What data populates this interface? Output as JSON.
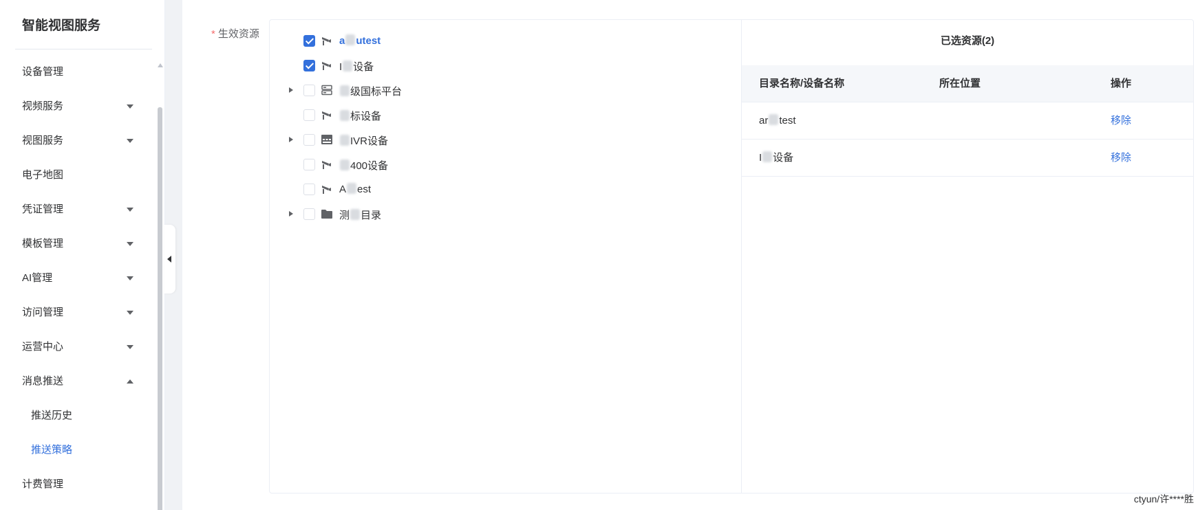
{
  "sidebar": {
    "brand": "智能视图服务",
    "items": [
      {
        "label": "设备管理",
        "caret": "none"
      },
      {
        "label": "视频服务",
        "caret": "down"
      },
      {
        "label": "视图服务",
        "caret": "down"
      },
      {
        "label": "电子地图",
        "caret": "none"
      },
      {
        "label": "凭证管理",
        "caret": "down"
      },
      {
        "label": "模板管理",
        "caret": "down"
      },
      {
        "label": "AI管理",
        "caret": "down"
      },
      {
        "label": "访问管理",
        "caret": "down"
      },
      {
        "label": "运营中心",
        "caret": "down"
      },
      {
        "label": "消息推送",
        "caret": "up"
      },
      {
        "label": "推送历史",
        "sub": true
      },
      {
        "label": "推送策略",
        "sub": true,
        "active": true
      },
      {
        "label": "计费管理",
        "caret": "none"
      }
    ]
  },
  "form": {
    "required_mark": "*",
    "label": "生效资源"
  },
  "tree": {
    "nodes": [
      {
        "label_pre": "a",
        "label_post": "utest",
        "checked": true,
        "expandable": false,
        "icon": "camera-icon",
        "highlight": true
      },
      {
        "label_pre": "I",
        "label_post": "设备",
        "checked": true,
        "expandable": false,
        "icon": "camera-icon"
      },
      {
        "label_pre": "",
        "label_post": "级国标平台",
        "checked": false,
        "expandable": true,
        "icon": "server-icon"
      },
      {
        "label_pre": "",
        "label_post": "标设备",
        "checked": false,
        "expandable": false,
        "icon": "camera-icon"
      },
      {
        "label_pre": "",
        "label_post": "IVR设备",
        "checked": false,
        "expandable": true,
        "icon": "nvr-icon"
      },
      {
        "label_pre": "",
        "label_post": "400设备",
        "checked": false,
        "expandable": false,
        "icon": "camera-icon"
      },
      {
        "label_pre": "A",
        "label_post": "est",
        "checked": false,
        "expandable": false,
        "icon": "camera-icon"
      },
      {
        "label_pre": "测",
        "label_post": "目录",
        "checked": false,
        "expandable": true,
        "icon": "folder-icon"
      }
    ]
  },
  "selected": {
    "title": "已选资源(2)",
    "columns": [
      "目录名称/设备名称",
      "所在位置",
      "操作"
    ],
    "rows": [
      {
        "name_pre": "ar",
        "name_post": "test",
        "location": "",
        "action": "移除"
      },
      {
        "name_pre": "I",
        "name_post": "设备",
        "location": "",
        "action": "移除"
      }
    ]
  },
  "footer": {
    "user": "ctyun/许****胜"
  },
  "colors": {
    "primary": "#3370dc",
    "required": "#f56c6c"
  }
}
